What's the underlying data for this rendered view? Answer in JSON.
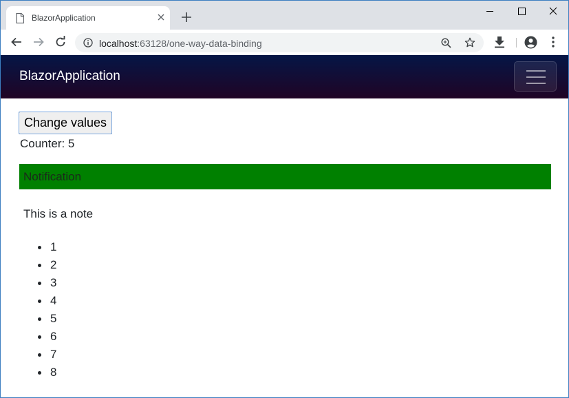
{
  "browser": {
    "tab_title": "BlazorApplication",
    "url_host": "localhost",
    "url_rest": ":63128/one-way-data-binding",
    "icons": [
      "page-icon",
      "close-icon",
      "plus-icon",
      "minimize-icon",
      "maximize-icon",
      "close-window-icon",
      "back-icon",
      "forward-icon",
      "reload-icon",
      "info-icon",
      "zoom-icon",
      "star-icon",
      "download-icon",
      "account-icon",
      "more-icon"
    ]
  },
  "navbar": {
    "brand": "BlazorApplication",
    "toggler_icon": "hamburger-icon"
  },
  "main": {
    "button_label": "Change values",
    "counter_text": "Counter: 5",
    "notification_text": "Notification",
    "notification_color": "#008000",
    "note_text": "This is a note",
    "list_items": [
      "1",
      "2",
      "3",
      "4",
      "5",
      "6",
      "7",
      "8"
    ]
  }
}
